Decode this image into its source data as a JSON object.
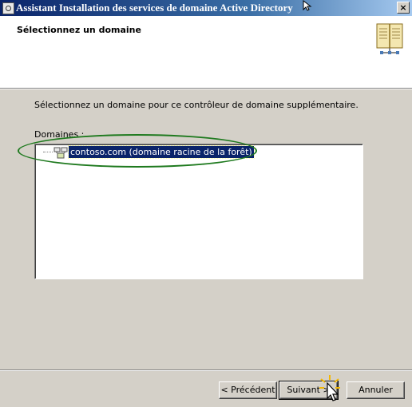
{
  "window": {
    "title": "Assistant Installation des services de domaine Active Directory",
    "close_label": "×"
  },
  "header": {
    "title": "Sélectionnez un domaine",
    "icon": "book-icon"
  },
  "main": {
    "instruction": "Sélectionnez un domaine pour ce contrôleur de domaine supplémentaire.",
    "list_label": "Domaines :",
    "domains": [
      {
        "label": "contoso.com (domaine racine de la forêt)",
        "selected": true,
        "icon": "domain-icon"
      }
    ]
  },
  "buttons": {
    "back": "< Précédent",
    "next": "Suivant >",
    "cancel": "Annuler"
  },
  "colors": {
    "selection": "#0a246a",
    "highlight_ellipse": "#1f7a1f",
    "dialog_bg": "#d4d0c8"
  }
}
